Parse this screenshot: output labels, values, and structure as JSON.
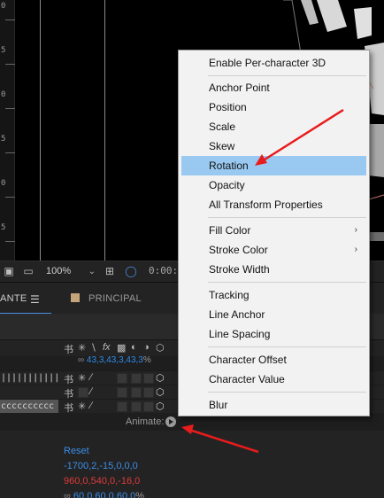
{
  "viewer": {
    "ruler_labels": [
      "0",
      "5",
      "0",
      "5",
      "0",
      "5"
    ],
    "zoom": "100%",
    "timecode": "0:00:0"
  },
  "tabs": [
    {
      "label": "ANTE",
      "active": true
    },
    {
      "label": "PRINCIPAL",
      "active": false
    }
  ],
  "tab_menu_icon": "hamburger-menu-icon",
  "timeline": {
    "scale_value_top": "43,3,43,3,43,3",
    "scale_value_top_unit": "%",
    "layer_names": [
      "||||||||||||",
      "",
      "cccccccccc"
    ],
    "animate_label": "Animate:",
    "reset_label": "Reset",
    "anchor_value": "-1700,2,-15,0,0,0",
    "position_value": "960,0,540,0,-16,0",
    "scale_value_bottom": "60,0,60,0,60,0",
    "scale_value_bottom_unit": "%"
  },
  "context_menu": {
    "items": [
      {
        "label": "Enable Per-character 3D"
      },
      {
        "label": "Anchor Point"
      },
      {
        "label": "Position"
      },
      {
        "label": "Scale"
      },
      {
        "label": "Skew"
      },
      {
        "label": "Rotation",
        "highlighted": true
      },
      {
        "label": "Opacity"
      },
      {
        "label": "All Transform Properties"
      },
      {
        "label": "Fill Color",
        "submenu": true
      },
      {
        "label": "Stroke Color",
        "submenu": true
      },
      {
        "label": "Stroke Width"
      },
      {
        "label": "Tracking"
      },
      {
        "label": "Line Anchor"
      },
      {
        "label": "Line Spacing"
      },
      {
        "label": "Character Offset"
      },
      {
        "label": "Character Value"
      },
      {
        "label": "Blur"
      }
    ],
    "submenu_glyph": "›"
  },
  "colors": {
    "menu_highlight": "#99c9f0",
    "accent_blue": "#3b8ee8",
    "value_red": "#e03b3b",
    "annotation_arrow": "#e81c1c"
  }
}
